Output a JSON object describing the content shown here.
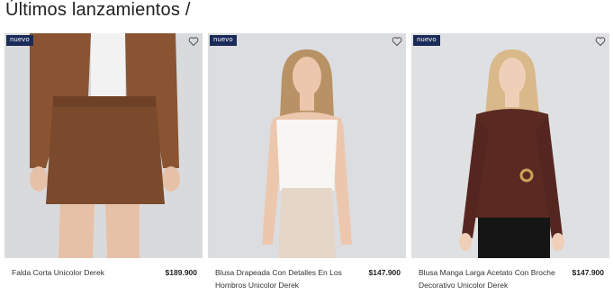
{
  "page": {
    "title": "Últimos lanzamientos /"
  },
  "products": [
    {
      "badge": "nuevo",
      "name": "Falda Corta Unicolor Derek",
      "price": "$189.900"
    },
    {
      "badge": "nuevo",
      "name": "Blusa Drapeada Con Detalles En Los Hombros Unicolor Derek",
      "price": "$147.900"
    },
    {
      "badge": "nuevo",
      "name": "Blusa Manga Larga Acetato Con Broche Decorativo Unicolor Derek",
      "price": "$147.900"
    }
  ],
  "icons": {
    "favorite": "heart-icon"
  },
  "colors": {
    "badge": "#1b2b59",
    "image_bg": "#d9dadc",
    "skirt": "#7b4a2c",
    "top_brown": "#5a2a22"
  }
}
